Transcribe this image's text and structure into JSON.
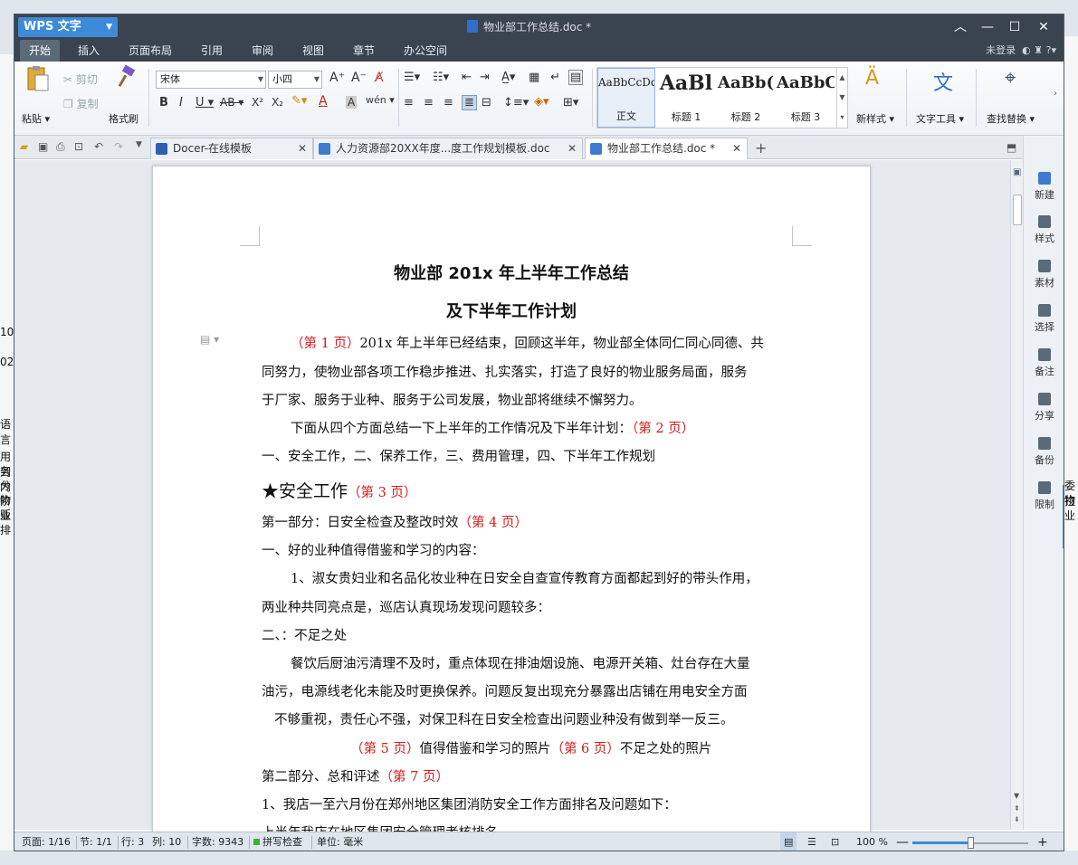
{
  "window": {
    "app": "WPS 文字",
    "title": "物业部工作总结.doc *"
  },
  "menu": {
    "tabs": [
      "开始",
      "插入",
      "页面布局",
      "引用",
      "审阅",
      "视图",
      "章节",
      "办公空间"
    ],
    "login": "未登录"
  },
  "ribbon": {
    "paste": "粘贴",
    "cut": "剪切",
    "copy": "复制",
    "format_painter": "格式刷",
    "font_name": "宋体",
    "font_size": "小四",
    "styles": [
      {
        "preview": "AaBbCcDd",
        "label": "正文"
      },
      {
        "preview": "AaBl",
        "label": "标题 1"
      },
      {
        "preview": "AaBb(",
        "label": "标题 2"
      },
      {
        "preview": "AaBbC",
        "label": "标题 3"
      }
    ],
    "new_style": "新样式",
    "text_tools": "文字工具",
    "find_replace": "查找替换"
  },
  "tabs": [
    {
      "label": "Docer-在线模板"
    },
    {
      "label": "人力资源部20XX年度...度工作规划模板.doc"
    },
    {
      "label": "物业部工作总结.doc *"
    }
  ],
  "document": {
    "title1": "物业部 201x 年上半年工作总结",
    "title2": "及下半年工作计划",
    "p1a": "（第 1 页）",
    "p1b": "201x 年上半年已经结束，回顾这半年，物业部全体同仁同心同德、共",
    "p1c": "同努力，使物业部各项工作稳步推进、扎实落实，打造了良好的物业服务局面，服务",
    "p1d": "于厂家、服务于业种、服务于公司发展，物业部将继续不懈努力。",
    "p2a": "下面从四个方面总结一下上半年的工作情况及下半年计划：",
    "p2b": "（第 2 页）",
    "p3": "一、安全工作，二、保养工作，三、费用管理，四、下半年工作规划",
    "h2a": "★安全工作",
    "h2b": "（第 3 页）",
    "p4a": "第一部分：日安全检查及整改时效",
    "p4b": "（第 4 页）",
    "p5": "一、好的业种值得借鉴和学习的内容：",
    "p6a": "1、淑女贵妇业和名品化妆业种在日安全自查宣传教育方面都起到好的带头作用，",
    "p6b": "两业种共同亮点是，巡店认真现场发现问题较多：",
    "p7": "二、：不足之处",
    "p8a": "餐饮后厨油污清理不及时，重点体现在排油烟设施、电源开关箱、灶台存在大量",
    "p8b": "油污，电源线老化未能及时更换保养。问题反复出现充分暴露出店铺在用电安全方面",
    "p8c": "不够重视，责任心不强，对保卫科在日安全检查出问题业种没有做到举一反三。",
    "p9a": "（第 5 页）",
    "p9b": "值得借鉴和学习的照片",
    "p9c": "（第 6 页）",
    "p9d": "不足之处的照片",
    "p10a": "第二部分、总和评述",
    "p10b": "（第 7 页）",
    "p11": "1、我店一至六月份在郑州地区集团消防安全工作方面排名及问题如下：",
    "p12": "上半年我店在地区集团安全管理考核排名"
  },
  "right_panel": [
    "新建",
    "样式",
    "素材",
    "选择",
    "备注",
    "分享",
    "备份",
    "限制"
  ],
  "status": {
    "page": "页面: 1/16",
    "section": "节: 1/1",
    "row": "行: 3",
    "col": "列: 10",
    "words": "字数: 9343",
    "spell": "拼写检查",
    "unit": "单位: 毫米",
    "zoom": "100 %"
  },
  "background_text": {
    "t1": "10",
    "t2": "02",
    "t3": "语言",
    "t4": "用到",
    "t5": "务内",
    "t6": "分阶",
    "t7": "物业",
    "t8": "贩排",
    "t9": "委拉",
    "t10": "物业"
  }
}
